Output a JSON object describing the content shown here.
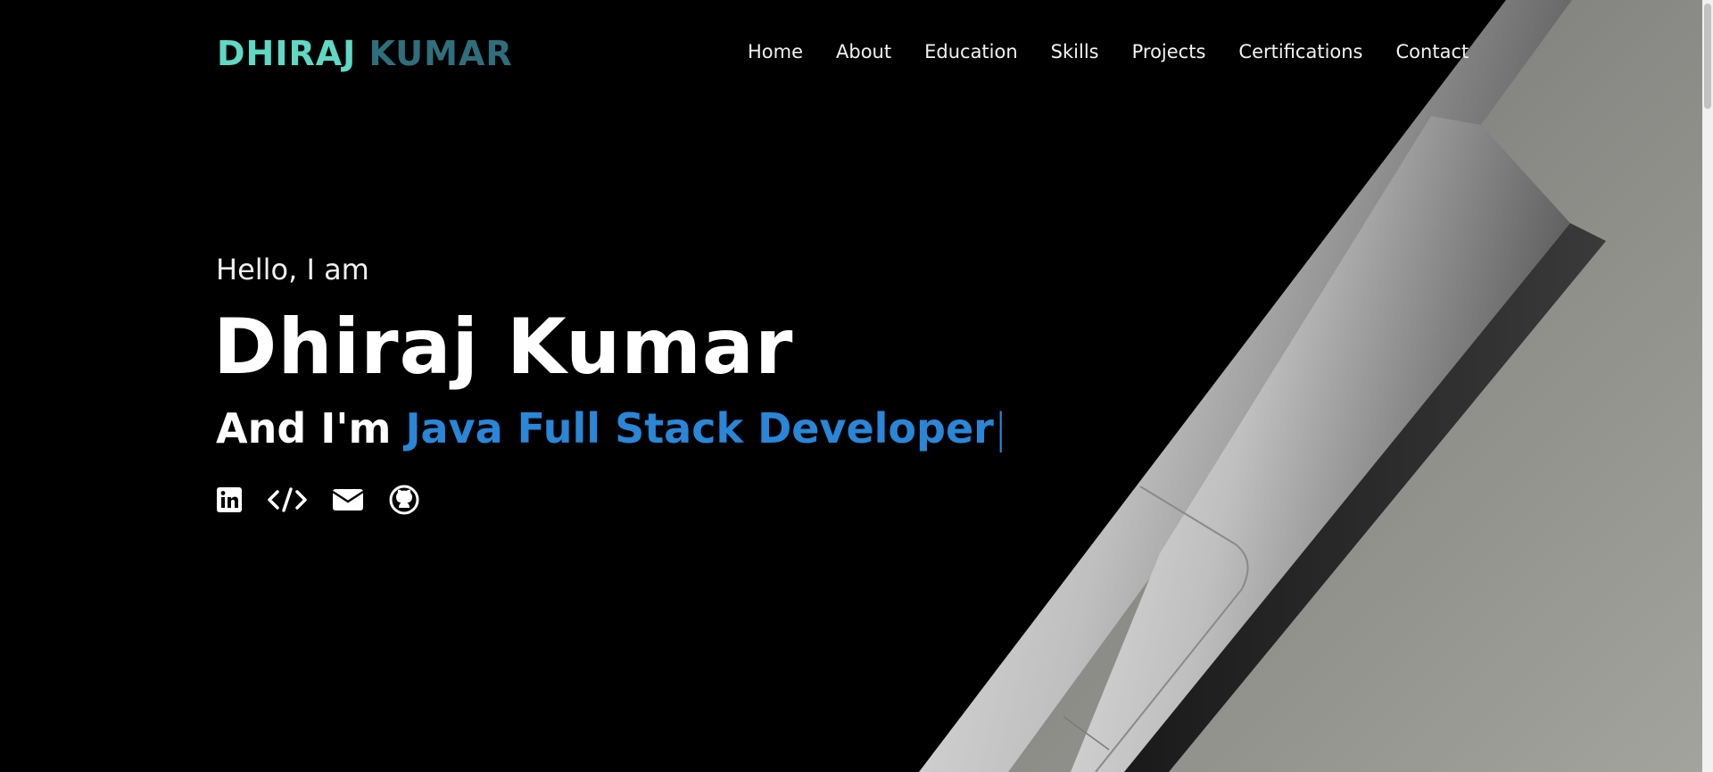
{
  "brand": {
    "first": "DHIRAJ",
    "last": "KUMAR"
  },
  "nav": {
    "items": [
      {
        "label": "Home"
      },
      {
        "label": "About"
      },
      {
        "label": "Education"
      },
      {
        "label": "Skills"
      },
      {
        "label": "Projects"
      },
      {
        "label": "Certifications"
      },
      {
        "label": "Contact"
      }
    ]
  },
  "hero": {
    "greeting": "Hello, I am",
    "name": "Dhiraj Kumar",
    "tagline_prefix": "And I'm ",
    "role": "Java Full Stack Developer",
    "cursor": "|"
  },
  "socials": [
    {
      "icon": "linkedin-icon"
    },
    {
      "icon": "code-icon"
    },
    {
      "icon": "mail-icon"
    },
    {
      "icon": "github-icon"
    }
  ],
  "colors": {
    "background": "#000000",
    "brand_first": "#5fd8c4",
    "brand_last": "#2f6f7c",
    "accent": "#2a86d6",
    "text": "#ffffff"
  }
}
